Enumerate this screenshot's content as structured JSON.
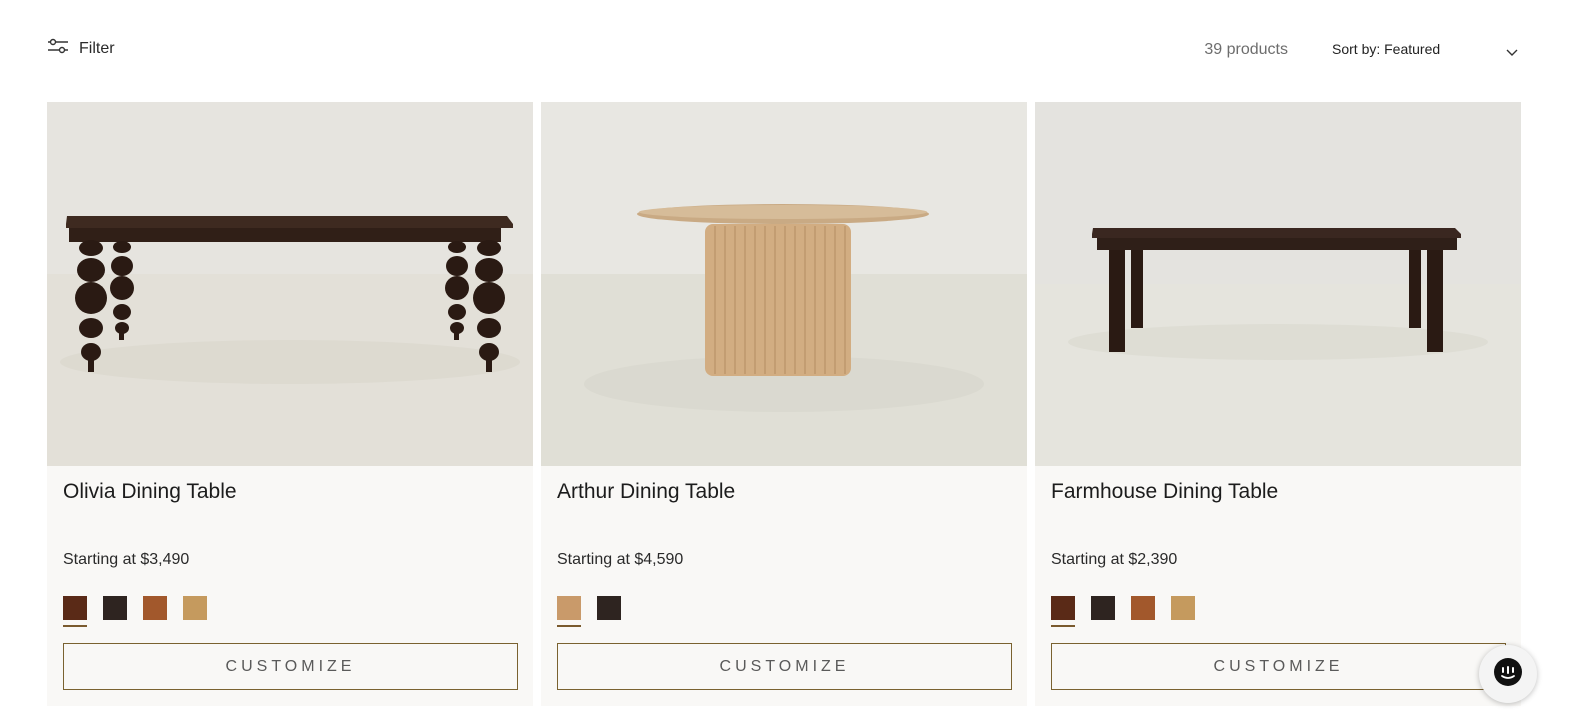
{
  "toolbar": {
    "filter_label": "Filter",
    "product_count": "39 products",
    "sort_label": "Sort by: Featured"
  },
  "products": [
    {
      "title": "Olivia Dining Table",
      "price": "Starting at $3,490",
      "cta": "CUSTOMIZE",
      "swatches": [
        {
          "color": "#5a2a17",
          "selected": true
        },
        {
          "color": "#2e2420",
          "selected": false
        },
        {
          "color": "#a2582c",
          "selected": false
        },
        {
          "color": "#c59a5e",
          "selected": false
        }
      ]
    },
    {
      "title": "Arthur Dining Table",
      "price": "Starting at $4,590",
      "cta": "CUSTOMIZE",
      "swatches": [
        {
          "color": "#c99a6a",
          "selected": true
        },
        {
          "color": "#2e2420",
          "selected": false
        }
      ]
    },
    {
      "title": "Farmhouse Dining Table",
      "price": "Starting at $2,390",
      "cta": "CUSTOMIZE",
      "swatches": [
        {
          "color": "#5a2a17",
          "selected": true
        },
        {
          "color": "#2e2420",
          "selected": false
        },
        {
          "color": "#a2582c",
          "selected": false
        },
        {
          "color": "#c59a5e",
          "selected": false
        }
      ]
    }
  ],
  "colors": {
    "accent": "#7a6230",
    "card_background": "#f9f8f6",
    "dark_wood": "#3b271d",
    "light_wood": "#d2ad82"
  },
  "icons": {
    "filter": "sliders-icon",
    "sort": "chevron-down-icon",
    "chat": "chat-bubble-icon"
  }
}
